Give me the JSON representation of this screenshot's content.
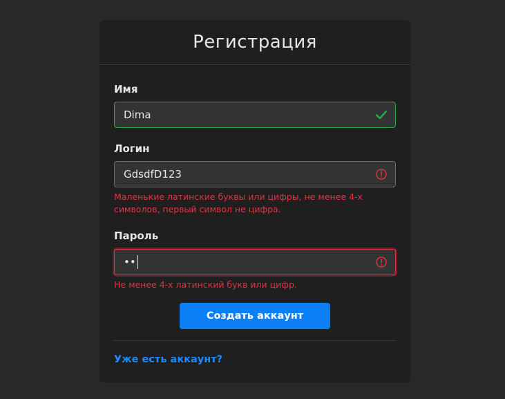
{
  "title": "Регистрация",
  "fields": {
    "name": {
      "label": "Имя",
      "value": "Dima",
      "status": "valid"
    },
    "login": {
      "label": "Логин",
      "value": "GdsdfD123",
      "status": "invalid",
      "error": "Маленькие латинские буквы или цифры, не менее 4-х символов, первый символ не цифра."
    },
    "password": {
      "label": "Пароль",
      "value": "••",
      "status": "invalid",
      "error": "Не менее 4-х латинский букв или цифр."
    }
  },
  "submit_label": "Создать аккаунт",
  "login_link": "Уже есть аккаунт?",
  "colors": {
    "accent": "#0d7ff5",
    "valid": "#28a745",
    "error": "#dc3545",
    "link": "#1a8cff"
  }
}
